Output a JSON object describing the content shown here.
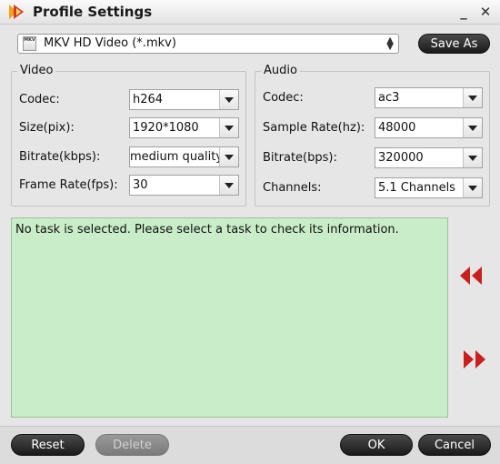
{
  "window": {
    "title": "Profile Settings",
    "minimize_label": "_",
    "close_label": "✕"
  },
  "profile": {
    "selected": "MKV HD Video (*.mkv)",
    "icon": "mkv-file-icon",
    "icon_text": "MKV"
  },
  "buttons": {
    "save_as": "Save As",
    "reset": "Reset",
    "delete": "Delete",
    "ok": "OK",
    "cancel": "Cancel"
  },
  "video": {
    "title": "Video",
    "codec": {
      "label": "Codec:",
      "value": "h264"
    },
    "size": {
      "label": "Size(pix):",
      "value": "1920*1080"
    },
    "bitrate": {
      "label": "Bitrate(kbps):",
      "value": "medium quality"
    },
    "framerate": {
      "label": "Frame Rate(fps):",
      "value": "30"
    }
  },
  "audio": {
    "title": "Audio",
    "codec": {
      "label": "Codec:",
      "value": "ac3"
    },
    "samplerate": {
      "label": "Sample Rate(hz):",
      "value": "48000"
    },
    "bitrate": {
      "label": "Bitrate(bps):",
      "value": "320000"
    },
    "channels": {
      "label": "Channels:",
      "value": "5.1 Channels"
    }
  },
  "info": {
    "message": "No task is selected. Please select a task to check its information."
  },
  "colors": {
    "info_bg": "#c9ecc9",
    "arrow_red": "#c8201e",
    "button_dark": "#2a2a2a"
  }
}
